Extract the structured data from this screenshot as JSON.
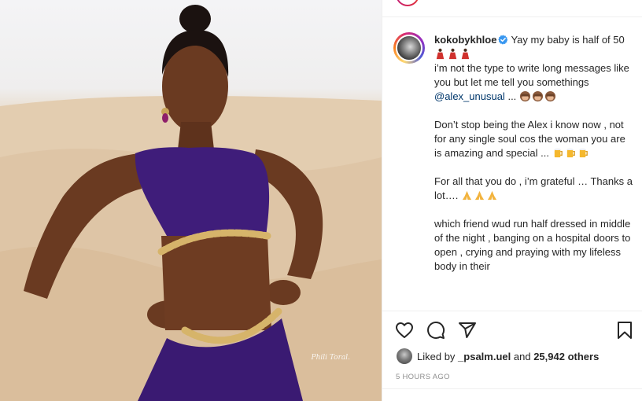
{
  "photo": {
    "watermark": "Phili Toral.",
    "description_colors": {
      "sky": "#f1f1f3",
      "sand": "#dcc3a4",
      "dress": "#3f1d7a",
      "skin": "#6b3b22"
    }
  },
  "post": {
    "username": "kokobykhloe",
    "verified": true,
    "caption_intro": "Yay my baby is half of 50",
    "para1_a": "i’m not the type to write long messages like you but let me tell you somethings",
    "mention": "@alex_unusual",
    "para1_b": "...",
    "para2": "Don’t stop being the Alex i know now , not for any single soul cos the woman you are is amazing and special ...",
    "para3": "For all that you do , i’m grateful … Thanks a lot….",
    "para4": "which friend wud run half dressed in middle of the night , banging on a hospital doors to open , crying and praying with my lifeless body in their"
  },
  "actions": {
    "icons": [
      "heart-icon",
      "comment-icon",
      "share-icon",
      "bookmark-icon"
    ],
    "liked_prefix": "Liked by",
    "liked_user": "_psalm.uel",
    "liked_and": "and",
    "liked_count": "25,942 others",
    "timestamp": "5 HOURS AGO"
  },
  "colors": {
    "mention": "#00376b",
    "verified": "#3897f0",
    "muted": "#8e8e8e"
  }
}
